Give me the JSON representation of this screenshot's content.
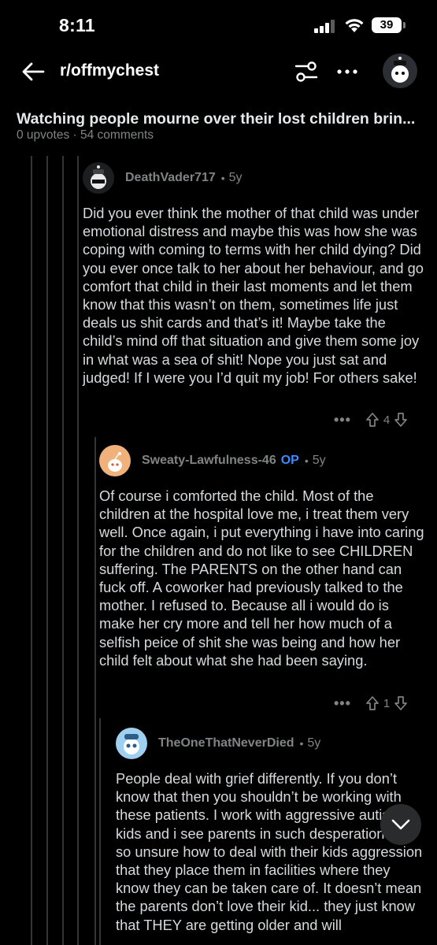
{
  "status_bar": {
    "time": "8:11",
    "battery": "39"
  },
  "header": {
    "subreddit": "r/offmychest"
  },
  "post": {
    "title": "Watching people mourne over their lost children brin...",
    "meta": "0 upvotes · 54 comments"
  },
  "comments": [
    {
      "author": "DeathVader717",
      "op": "",
      "age": "5y",
      "body": "Did you ever think the mother of that child was under emotional distress and maybe this was how she was coping with coming to terms with her child dying? Did you ever once talk to her about her behaviour, and go comfort that child in their last moments and let them know that this wasn’t on them, sometimes life just deals us shit cards and that’s it! Maybe take the child’s mind off that situation and give them some joy in what was a sea of shit! Nope you just sat and judged! If I were you I’d quit my job! For others sake!",
      "score": "4"
    },
    {
      "author": "Sweaty-Lawfulness-46",
      "op": "OP",
      "age": "5y",
      "body": "Of course i comforted the child. Most of the children at the hospital love me, i treat them very well. Once again, i put everything i have into caring for the children and do not like to see CHILDREN suffering. The PARENTS on the other hand can fuck off. A coworker had previously talked to the mother. I refused to. Because all i would do is make her cry more and tell her how much of a selfish peice of shit she was being and how her child felt about what she had been saying.",
      "score": "1"
    },
    {
      "author": "TheOneThatNeverDied",
      "op": "",
      "age": "5y",
      "body": "People deal with grief differently. If you don’t know that then you shouldn’t be working with these patients. I work with aggressive autistic kids and i see parents in such desperation and so unsure how to deal with their kids aggression that they place them in facilities where they know they can be taken care of. It doesn’t mean the parents don’t love their kid... they just know that THEY are getting older and will",
      "score": ""
    }
  ],
  "icons": {
    "back": "arrow-left-icon",
    "filter": "sort-filter-icon",
    "more": "more-dots-icon",
    "upvote": "upvote-arrow-icon",
    "downvote": "downvote-arrow-icon",
    "scroll": "chevron-down-icon"
  },
  "colors": {
    "background": "#000000",
    "op_tag": "#3d8bff",
    "meta": "#818384",
    "text": "#d7dadc"
  }
}
